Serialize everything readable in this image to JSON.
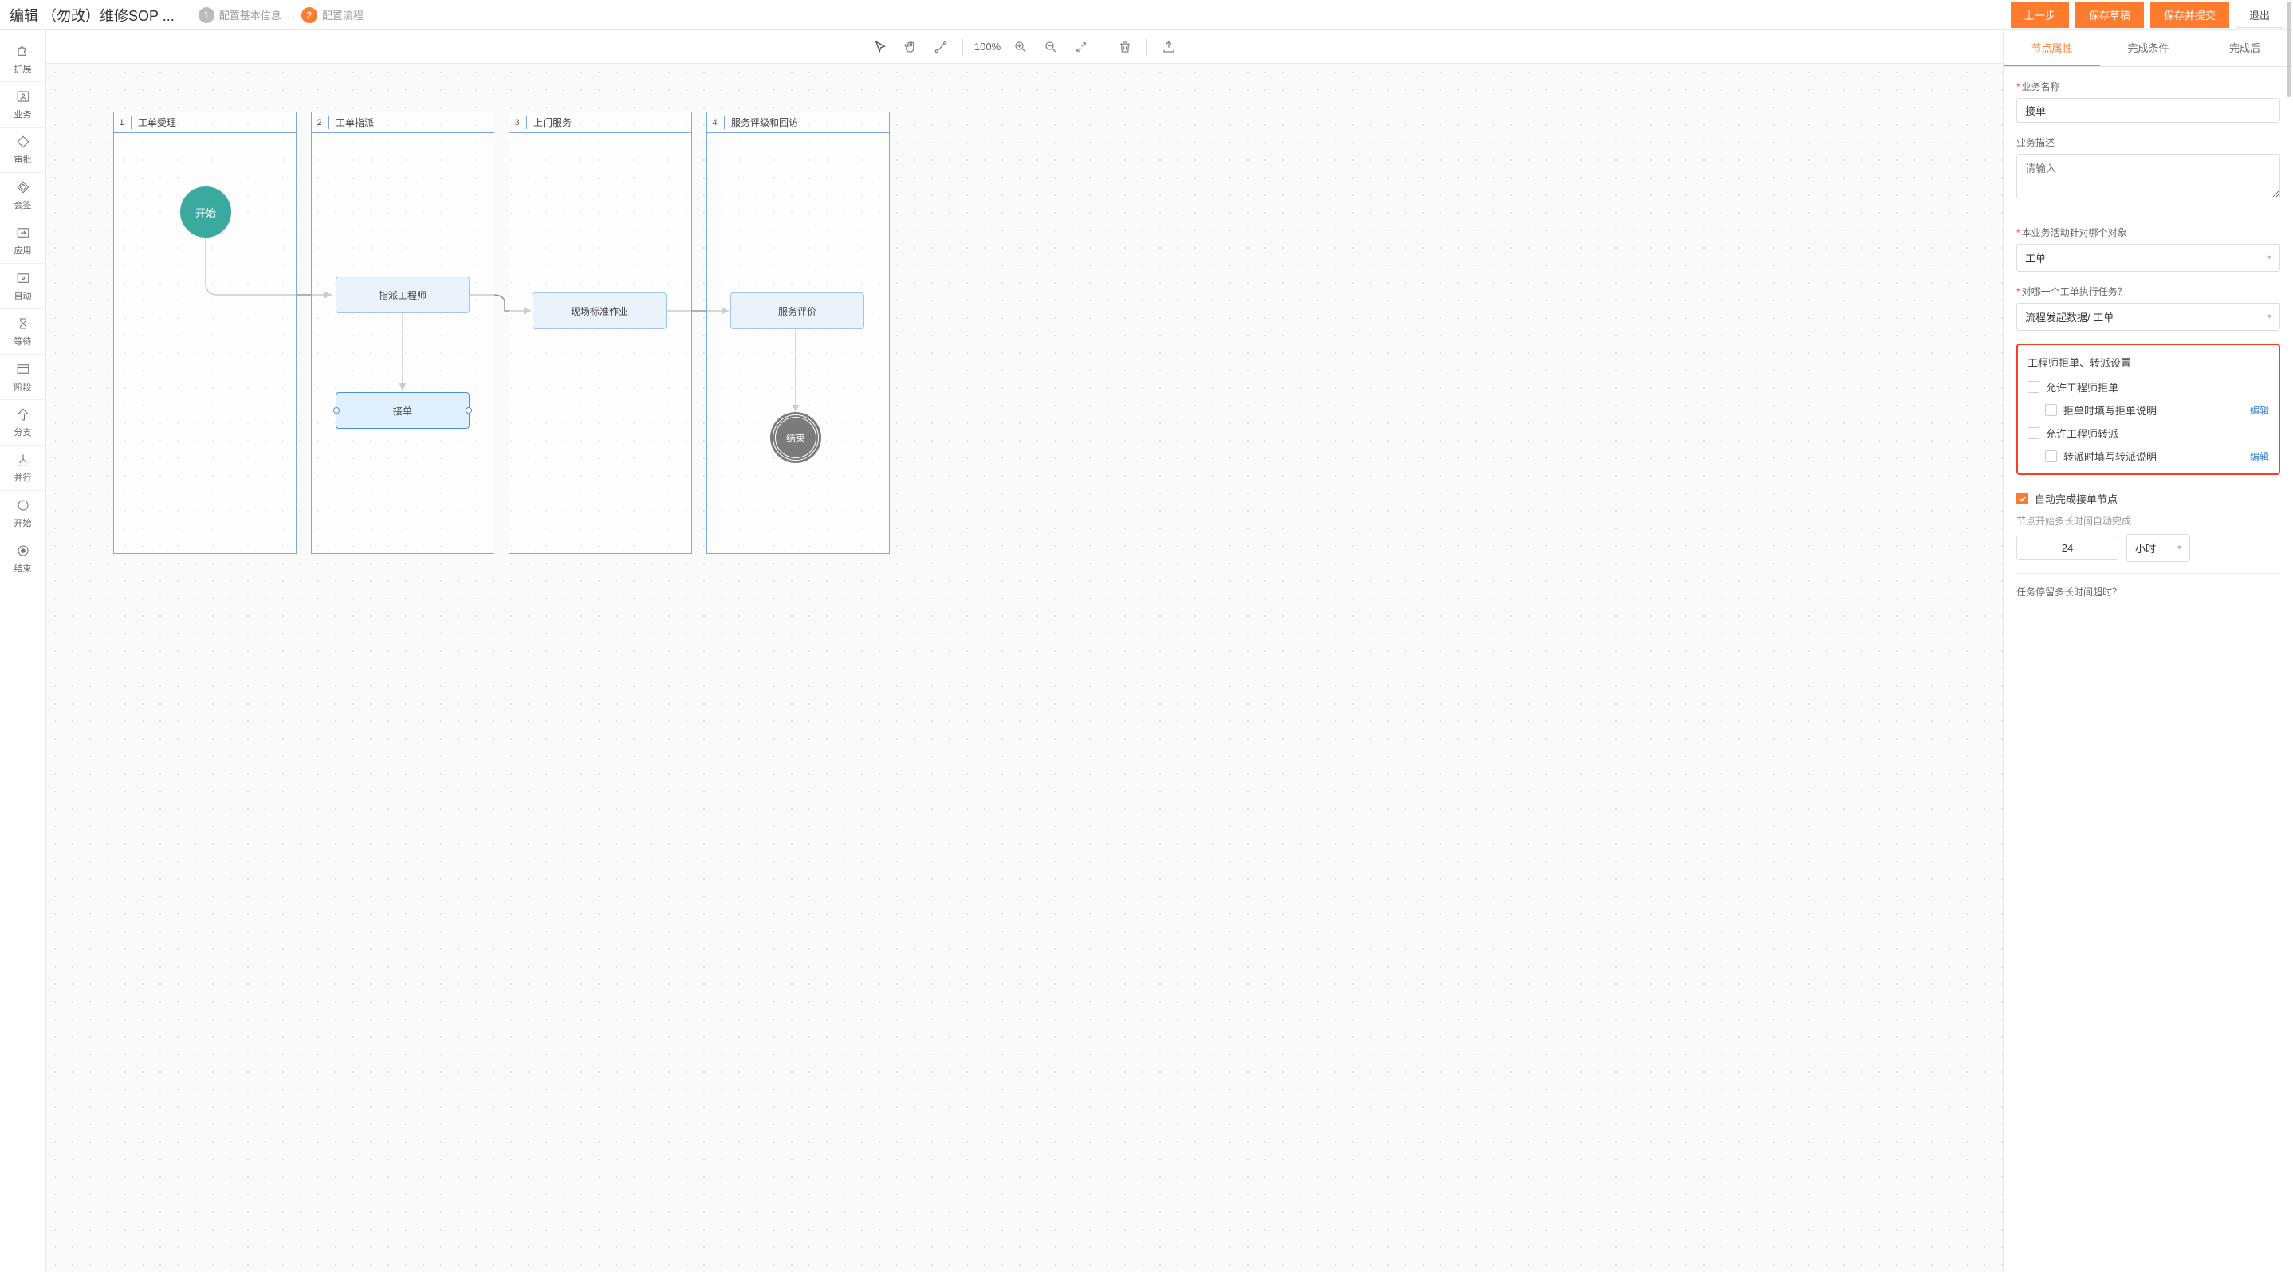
{
  "header": {
    "title": "编辑 （勿改）维修SOP ...",
    "step1": "配置基本信息",
    "step2": "配置流程",
    "prev": "上一步",
    "save_draft": "保存草稿",
    "save_submit": "保存并提交",
    "exit": "退出"
  },
  "toolbox": {
    "extend": "扩展",
    "business": "业务",
    "approve": "审批",
    "countersign": "会签",
    "app": "应用",
    "auto": "自动",
    "wait": "等待",
    "stage": "阶段",
    "branch": "分支",
    "parallel": "并行",
    "start": "开始",
    "end": "结束"
  },
  "toolbar": {
    "zoom": "100%"
  },
  "lanes": [
    {
      "num": "1",
      "title": "工单受理"
    },
    {
      "num": "2",
      "title": "工单指派"
    },
    {
      "num": "3",
      "title": "上门服务"
    },
    {
      "num": "4",
      "title": "服务评级和回访"
    }
  ],
  "nodes": {
    "start": "开始",
    "assign": "指派工程师",
    "accept": "接单",
    "onsite": "现场标准作业",
    "rating": "服务评价",
    "end": "结束"
  },
  "panel": {
    "tab1": "节点属性",
    "tab2": "完成条件",
    "tab3": "完成后",
    "biz_name_label": "业务名称",
    "biz_name_value": "接单",
    "biz_desc_label": "业务描述",
    "biz_desc_placeholder": "请输入",
    "target_label": "本业务活动针对哪个对象",
    "target_value": "工单",
    "which_label": "对哪一个工单执行任务？",
    "which_value": "流程发起数据/ 工单",
    "reject_section_title": "工程师拒单、转派设置",
    "allow_reject": "允许工程师拒单",
    "reject_note": "拒单时填写拒单说明",
    "allow_transfer": "允许工程师转派",
    "transfer_note": "转派时填写转派说明",
    "edit_link": "编辑",
    "auto_complete": "自动完成接单节点",
    "auto_hint": "节点开始多长时间自动完成",
    "auto_value": "24",
    "auto_unit": "小时",
    "timeout_label": "任务停留多长时间超时？"
  }
}
